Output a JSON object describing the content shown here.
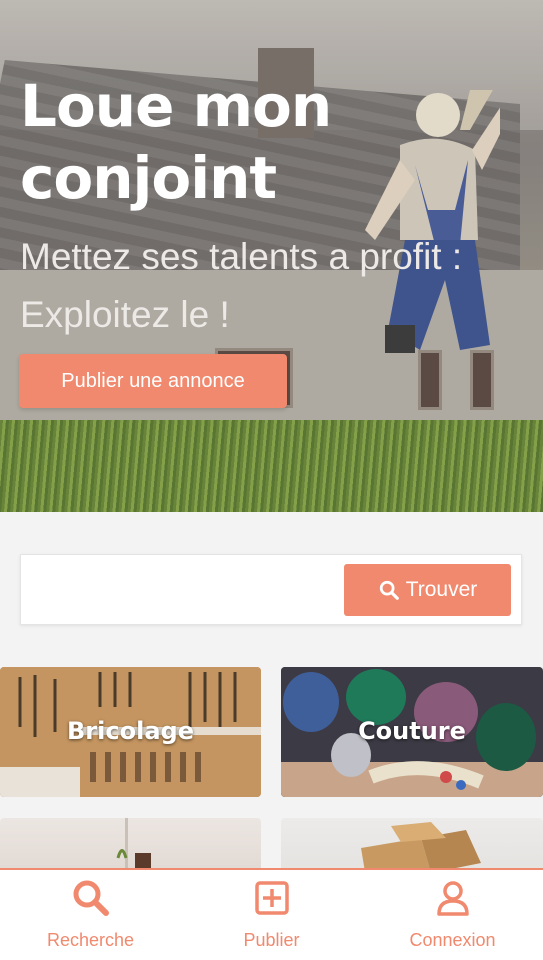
{
  "hero": {
    "title_line1": "Loue mon",
    "title_line2": "conjoint",
    "subtitle_line1": "Mettez ses talents a profit :",
    "subtitle_line2": "Exploitez le !",
    "publish_button": "Publier une annonce"
  },
  "search": {
    "input_value": "",
    "button_label": "Trouver"
  },
  "categories": [
    {
      "label": "Bricolage"
    },
    {
      "label": "Couture"
    },
    {
      "label": ""
    },
    {
      "label": ""
    }
  ],
  "bottom_nav": {
    "items": [
      {
        "label": "Recherche",
        "icon": "search-icon"
      },
      {
        "label": "Publier",
        "icon": "plus-square-icon"
      },
      {
        "label": "Connexion",
        "icon": "user-icon"
      }
    ]
  },
  "colors": {
    "accent": "#f0896e",
    "background": "#f3f3f3"
  }
}
